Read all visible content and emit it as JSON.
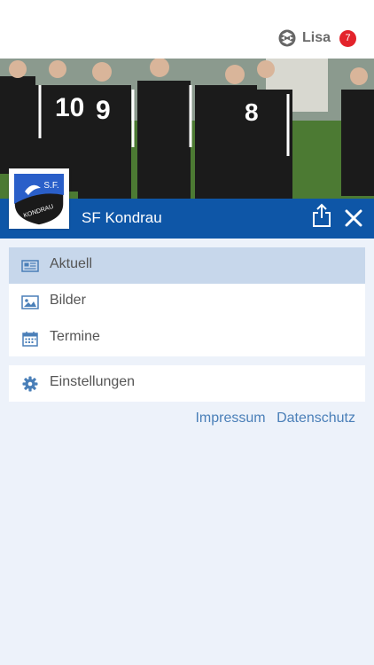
{
  "header": {
    "user_name": "Lisa",
    "notification_count": "7",
    "user_icon": "network-logo-icon"
  },
  "club": {
    "name": "SF Kondrau",
    "logo_text_top": "S.F.",
    "logo_text_bottom": "KONDRAU"
  },
  "menu": {
    "items": [
      {
        "label": "Aktuell",
        "icon": "newspaper-icon",
        "active": true
      },
      {
        "label": "Bilder",
        "icon": "image-icon",
        "active": false
      },
      {
        "label": "Termine",
        "icon": "calendar-icon",
        "active": false
      }
    ],
    "settings": {
      "label": "Einstellungen",
      "icon": "gear-icon"
    }
  },
  "footer": {
    "impressum": "Impressum",
    "datenschutz": "Datenschutz"
  },
  "colors": {
    "brand_blue": "#0e56a7",
    "active_bg": "#c7d7eb",
    "badge_red": "#e3232b",
    "link": "#4a7fb8"
  }
}
